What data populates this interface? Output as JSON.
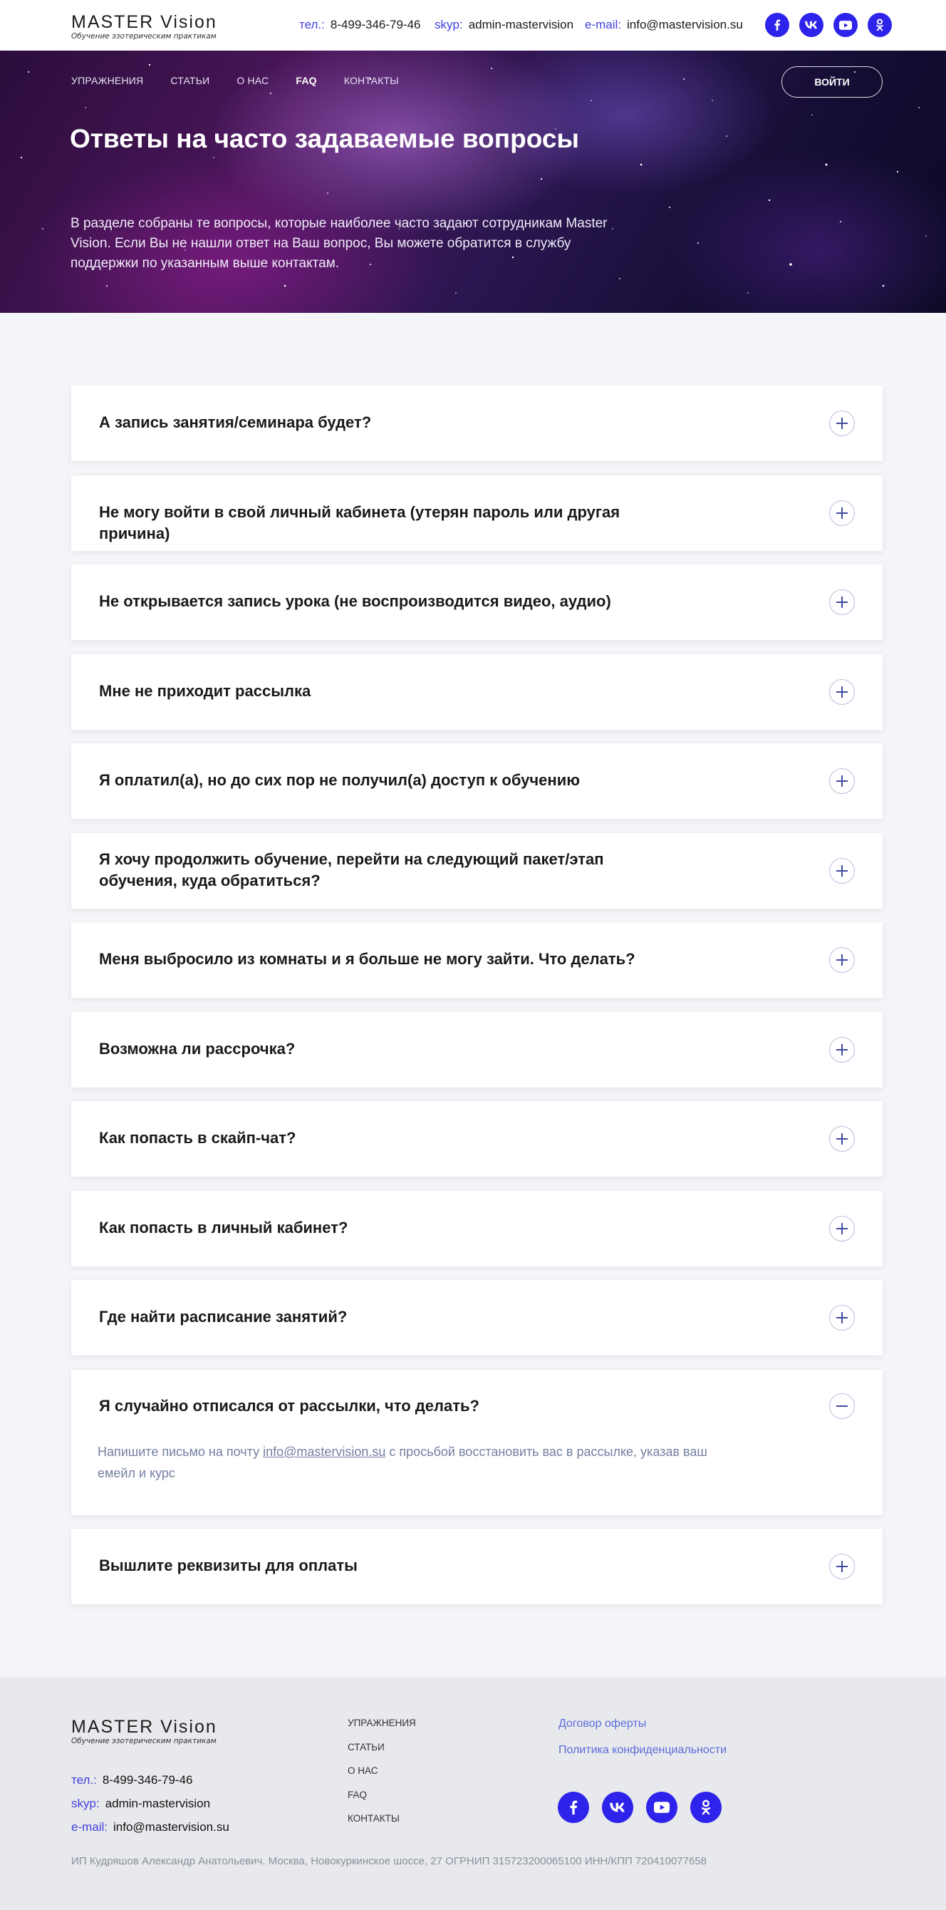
{
  "brand": {
    "name": "MASTER  Vision",
    "tagline": "Обучение эзотерическим практикам"
  },
  "contacts": {
    "phone_label": "тел.:",
    "phone": "8-499-346-79-46",
    "skype_label": "skyp:",
    "skype": "admin-mastervision",
    "email_label": "e-mail:",
    "email": "info@mastervision.su"
  },
  "socials": [
    "facebook-icon",
    "vk-icon",
    "youtube-icon",
    "odnoklassniki-icon"
  ],
  "colors": {
    "accent": "#2d23ea",
    "link": "#5b6cdc",
    "answer": "#7580a3"
  },
  "nav": {
    "items": [
      "УПРАЖНЕНИЯ",
      "СТАТЬИ",
      "О НАС",
      "FAQ",
      "КОНТАКТЫ"
    ],
    "active": "FAQ",
    "login_label": "ВОЙТИ"
  },
  "hero": {
    "title": "Ответы на часто задаваемые вопросы",
    "text": "В разделе собраны те вопросы, которые наиболее часто задают сотрудникам Master Vision. Если Вы не нашли ответ на Ваш вопрос, Вы можете обратится в службу поддержки по указанным выше контактам."
  },
  "faq": [
    {
      "question": "А запись занятия/семинара будет?",
      "expanded": false
    },
    {
      "question": "Не могу войти в свой личный кабинета (утерян пароль или другая причина)",
      "expanded": false
    },
    {
      "question": "Не открывается запись урока (не воспроизводится видео, аудио)",
      "expanded": false
    },
    {
      "question": "Мне не приходит рассылка",
      "expanded": false
    },
    {
      "question": "Я оплатил(а), но до сих пор не получил(а) доступ к обучению",
      "expanded": false
    },
    {
      "question": "Я хочу продолжить обучение, перейти на следующий пакет/этап обучения, куда обратиться?",
      "expanded": false
    },
    {
      "question": "Меня выбросило из комнаты и я больше не могу зайти. Что делать?",
      "expanded": false
    },
    {
      "question": "Возможна ли рассрочка?",
      "expanded": false
    },
    {
      "question": "Как попасть в скайп-чат?",
      "expanded": false
    },
    {
      "question": "Как попасть в личный кабинет?",
      "expanded": false
    },
    {
      "question": "Где найти расписание занятий?",
      "expanded": false
    },
    {
      "question": "Я случайно отписался от рассылки, что делать?",
      "expanded": true,
      "answer_before": "Напишите письмо на почту ",
      "answer_link": "info@mastervision.su",
      "answer_after": " с просьбой восстановить вас в рассылке, указав ваш емейл и курс"
    },
    {
      "question": "Вышлите реквизиты для оплаты",
      "expanded": false
    }
  ],
  "footer": {
    "nav": [
      "УПРАЖНЕНИЯ",
      "СТАТЬИ",
      "О НАС",
      "FAQ",
      "КОНТАКТЫ"
    ],
    "links": [
      "Договор оферты",
      "Политика конфиденциальности"
    ],
    "legal": "ИП Кудряшов Александр Анатольевич. Москва, Новокуркинское шоссе, 27 ОГРНИП 315723200065100 ИНН/КПП 720410077658"
  }
}
